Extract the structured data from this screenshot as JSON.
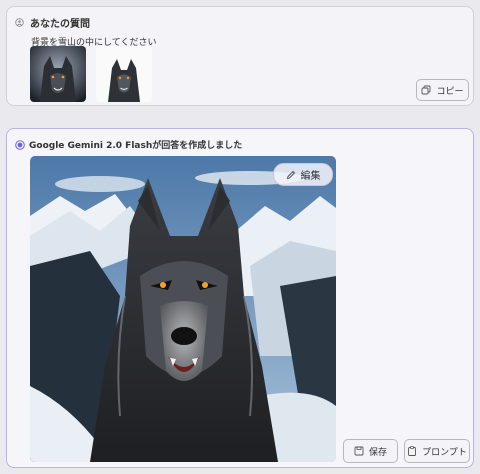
{
  "question": {
    "header": "あなたの質問",
    "text": "背景を雪山の中にしてください",
    "copy_label": "コピー",
    "icons": {
      "user": "user-icon",
      "copy": "copy-icon"
    }
  },
  "answer": {
    "header": "Google Gemini 2.0 Flashが回答を作成しました",
    "edit_label": "編集",
    "save_label": "保存",
    "prompt_label": "プロンプト",
    "icons": {
      "radio": "radio-selected-icon",
      "edit": "pencil-icon",
      "save": "save-icon",
      "prompt": "clipboard-icon"
    }
  },
  "colors": {
    "accent": "#6b63d9",
    "card_border_active": "#b9b3e6",
    "background": "#e9e9ee"
  }
}
